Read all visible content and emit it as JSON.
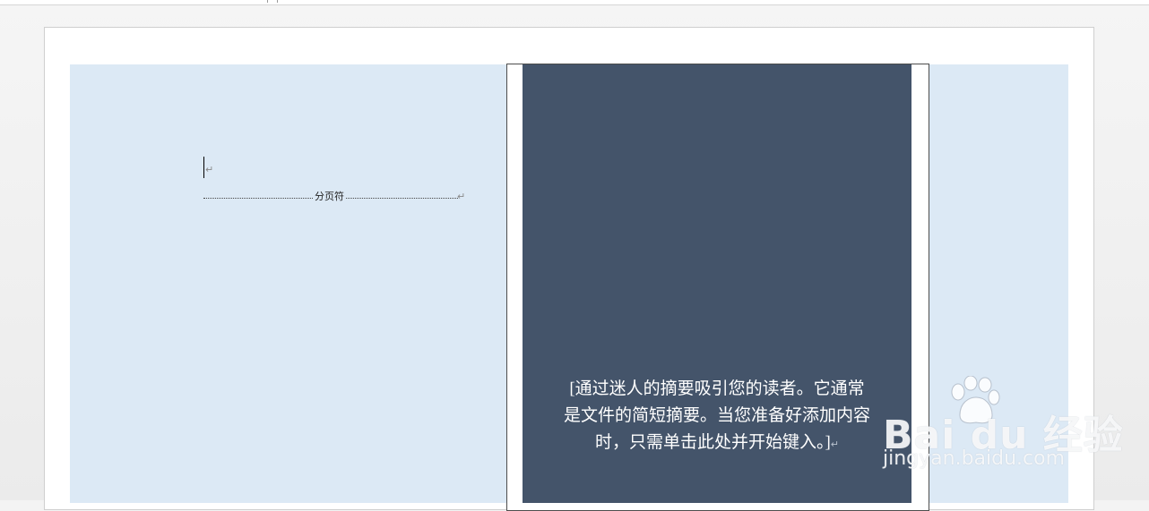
{
  "document": {
    "page_break_label": "分页符",
    "paragraph_mark": "↵"
  },
  "sidebar": {
    "abstract_line1": "[通过迷人的摘要吸引您的读者。它通常",
    "abstract_line2": "是文件的简短摘要。当您准备好添加内容",
    "abstract_line3": "时，只需单击此处并开始键入。]"
  },
  "watermark": {
    "brand": "Bai du 经验",
    "url": "jingyan.baidu.com"
  },
  "colors": {
    "page_background": "#dce9f5",
    "sidebar_panel": "#44546a",
    "abstract_text": "#ffffff"
  }
}
